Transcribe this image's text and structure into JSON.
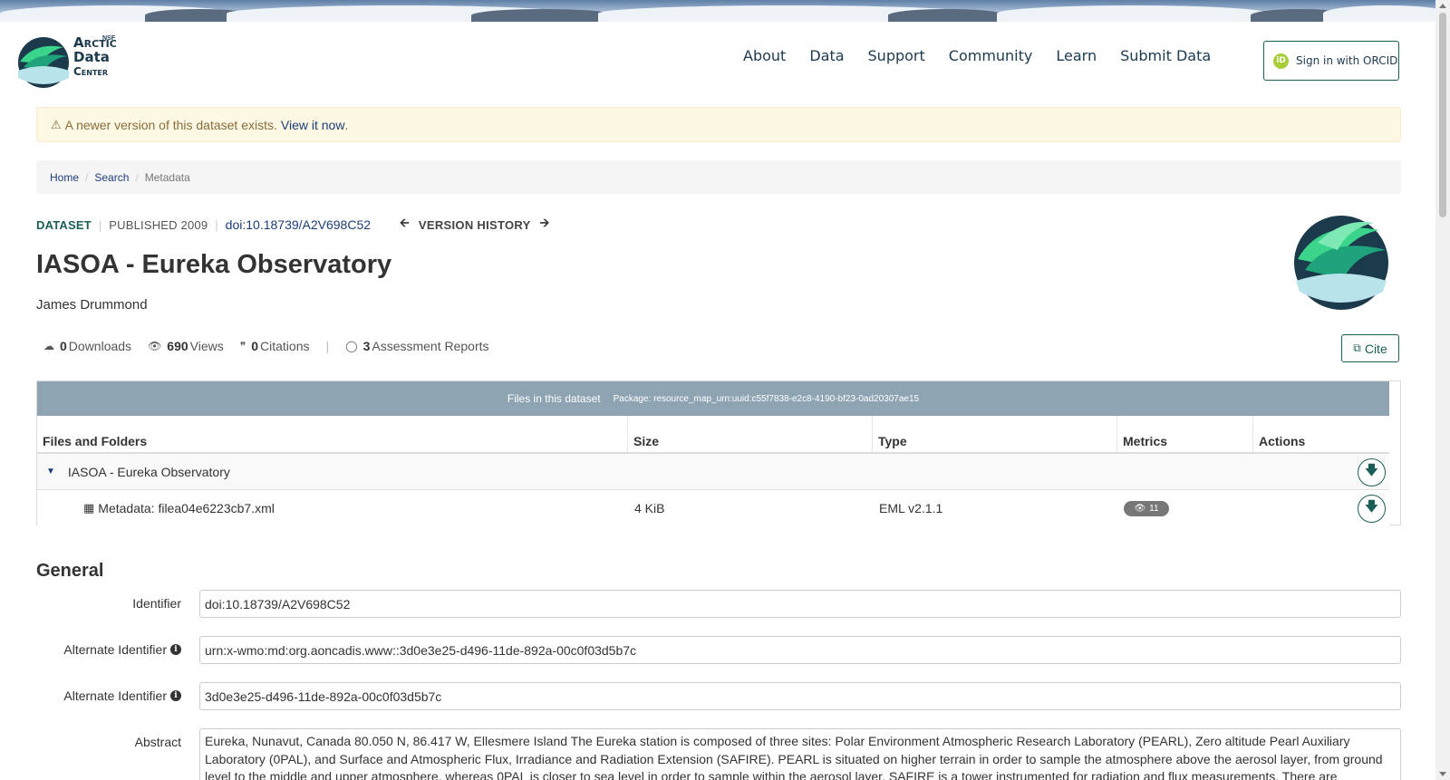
{
  "header": {
    "logo": {
      "nsf": "NSF",
      "line1": "Arctic",
      "line2": "Data",
      "line3": "Center"
    },
    "nav": [
      "About",
      "Data",
      "Support",
      "Community",
      "Learn",
      "Submit Data"
    ],
    "orcid_label": "Sign in with ORCID",
    "orcid_icon": "iD"
  },
  "alert": {
    "icon": "warning-icon",
    "text": "A newer version of this dataset exists.",
    "link": "View it now",
    "trailing": "."
  },
  "breadcrumb": [
    "Home",
    "Search",
    "Metadata"
  ],
  "dataset": {
    "type_label": "DATASET",
    "published": "PUBLISHED 2009",
    "doi": "doi:10.18739/A2V698C52",
    "version_history": "VERSION HISTORY",
    "title": "IASOA - Eureka Observatory",
    "author": "James Drummond"
  },
  "stats": {
    "downloads_count": "0",
    "downloads_label": "Downloads",
    "views_count": "690",
    "views_label": "Views",
    "citations_count": "0",
    "citations_label": "Citations",
    "reports_count": "3",
    "reports_label": "Assessment Reports"
  },
  "cite_label": "Cite",
  "files": {
    "heading": "Files in this dataset",
    "package": "Package: resource_map_urn:uuid:c55f7838-e2c8-4190-bf23-0ad20307ae15",
    "columns": [
      "Files and Folders",
      "Size",
      "Type",
      "Metrics",
      "Actions"
    ],
    "folder_name": "IASOA - Eureka Observatory",
    "file": {
      "name": "Metadata: filea04e6223cb7.xml",
      "size": "4 KiB",
      "type": "EML v2.1.1",
      "views": "11"
    }
  },
  "general": {
    "title": "General",
    "fields": [
      {
        "label": "Identifier",
        "value": "doi:10.18739/A2V698C52"
      },
      {
        "label": "Alternate Identifier",
        "value": "urn:x-wmo:md:org.aoncadis.www::3d0e3e25-d496-11de-892a-00c0f03d5b7c"
      },
      {
        "label": "Alternate Identifier",
        "value": "3d0e3e25-d496-11de-892a-00c0f03d5b7c"
      },
      {
        "label": "Abstract",
        "value": "Eureka, Nunavut, Canada 80.050 N, 86.417 W, Ellesmere Island The Eureka station is composed of three sites: Polar Environment Atmospheric Research Laboratory (PEARL), Zero altitude Pearl Auxiliary Laboratory (0PAL), and Surface and Atmospheric Flux, Irradiance and Radiation Extension (SAFIRE). PEARL is situated on higher terrain in order to sample the atmosphere above the aerosol layer, from ground level to the middle and upper atmosphere, whereas 0PAL is closer to sea level in order to sample within the aerosol layer. SAFIRE is a tower instrumented for radiation and flux measurements. There are"
      }
    ],
    "info_icon": "i"
  },
  "colors": {
    "brand_teal": "#1b5e57",
    "link_blue": "#1c3d78",
    "files_header": "#8ea4b2",
    "alert_bg": "#fcf8e3"
  }
}
